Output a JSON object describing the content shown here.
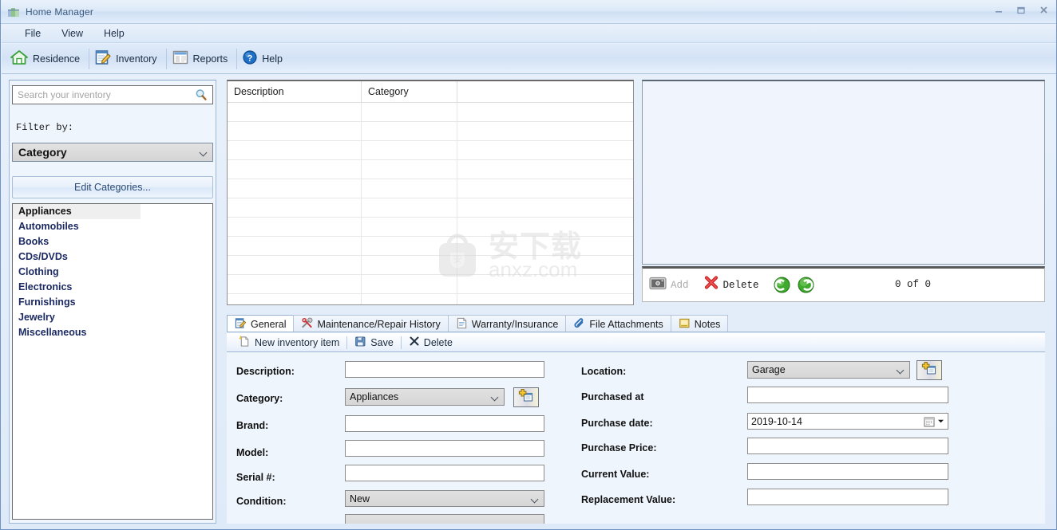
{
  "window": {
    "title": "Home Manager",
    "icon": "app-icon",
    "controls": {
      "minimize": "–",
      "maximize": "❐",
      "close": "✕"
    }
  },
  "menubar": {
    "items": [
      {
        "label": "File"
      },
      {
        "label": "View"
      },
      {
        "label": "Help"
      }
    ]
  },
  "toolbar": {
    "buttons": [
      {
        "label": "Residence",
        "icon": "house-icon"
      },
      {
        "label": "Inventory",
        "icon": "notepad-pencil-icon"
      },
      {
        "label": "Reports",
        "icon": "report-window-icon"
      },
      {
        "label": "Help",
        "icon": "question-mark-icon"
      }
    ]
  },
  "sidebar": {
    "search": {
      "placeholder": "Search your inventory",
      "value": "",
      "icon": "magnifier-icon"
    },
    "filter_label": "Filter by:",
    "filter_combo": {
      "value": "Category",
      "icon": "chevron-down-icon"
    },
    "edit_categories_label": "Edit Categories...",
    "categories": [
      {
        "label": "Appliances",
        "selected": true
      },
      {
        "label": "Automobiles",
        "selected": false
      },
      {
        "label": "Books",
        "selected": false
      },
      {
        "label": "CDs/DVDs",
        "selected": false
      },
      {
        "label": "Clothing",
        "selected": false
      },
      {
        "label": "Electronics",
        "selected": false
      },
      {
        "label": "Furnishings",
        "selected": false
      },
      {
        "label": "Jewelry",
        "selected": false
      },
      {
        "label": "Miscellaneous",
        "selected": false
      }
    ]
  },
  "grid": {
    "columns": [
      {
        "label": "Description"
      },
      {
        "label": "Category"
      },
      {
        "label": ""
      }
    ],
    "rows": []
  },
  "watermark": {
    "cn": "安下载",
    "url": "anxz.com",
    "badge": "安"
  },
  "image_panel": {
    "toolbar": {
      "add_label": "Add",
      "add_icon": "camera-icon",
      "delete_label": "Delete",
      "delete_icon": "red-x-icon",
      "prev_icon": "green-left-arrow-icon",
      "next_icon": "green-right-arrow-icon",
      "counter": "0 of 0"
    }
  },
  "tabs": [
    {
      "label": "General",
      "icon": "notepad-pencil-icon",
      "active": true
    },
    {
      "label": "Maintenance/Repair History",
      "icon": "tools-icon",
      "active": false
    },
    {
      "label": "Warranty/Insurance",
      "icon": "document-icon",
      "active": false
    },
    {
      "label": "File Attachments",
      "icon": "paperclip-icon",
      "active": false
    },
    {
      "label": "Notes",
      "icon": "note-icon",
      "active": false
    }
  ],
  "action_bar": {
    "buttons": [
      {
        "label": "New inventory item",
        "icon": "new-page-icon"
      },
      {
        "label": "Save",
        "icon": "floppy-disk-icon"
      },
      {
        "label": "Delete",
        "icon": "x-icon"
      }
    ]
  },
  "form": {
    "left": [
      {
        "label": "Description:",
        "type": "text",
        "value": ""
      },
      {
        "label": "Category:",
        "type": "select",
        "value": "Appliances",
        "picker": true,
        "picker_icon": "add-record-icon"
      },
      {
        "label": "Brand:",
        "type": "text",
        "value": ""
      },
      {
        "label": "Model:",
        "type": "text",
        "value": ""
      },
      {
        "label": "Serial #:",
        "type": "text",
        "value": ""
      },
      {
        "label": "Condition:",
        "type": "select",
        "value": "New"
      }
    ],
    "right": [
      {
        "label": "Location:",
        "type": "select",
        "value": "Garage",
        "picker": true,
        "picker_icon": "add-record-icon"
      },
      {
        "label": "Purchased at",
        "type": "text",
        "value": ""
      },
      {
        "label": "Purchase date:",
        "type": "date",
        "value": "2019-10-14",
        "icon": "calendar-icon"
      },
      {
        "label": "Purchase Price:",
        "type": "text",
        "value": ""
      },
      {
        "label": "Current Value:",
        "type": "text",
        "value": ""
      },
      {
        "label": "Replacement Value:",
        "type": "text",
        "value": ""
      }
    ]
  },
  "colors": {
    "window_bg": "#eff5fd",
    "accent_blue": "#2c4a73",
    "category_text": "#1b2a63",
    "border": "#9fb8d6",
    "title_text": "#3b5a7e"
  }
}
